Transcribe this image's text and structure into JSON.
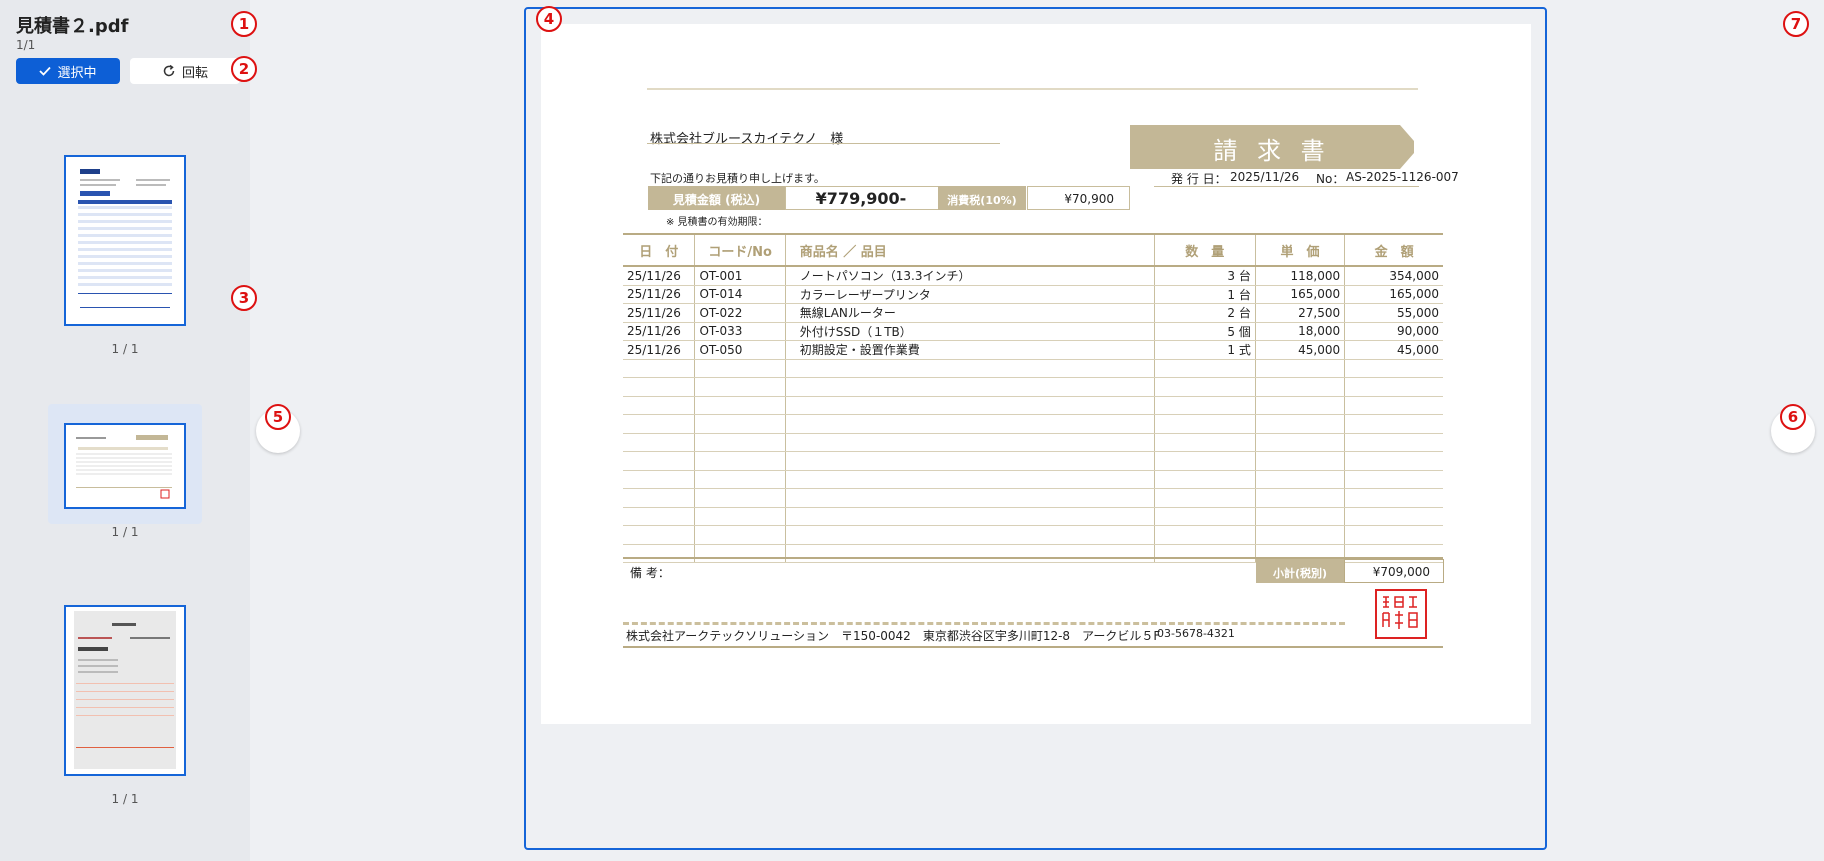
{
  "header": {
    "file_title": "見積書２.pdf",
    "page_count": "1/1",
    "select_button": "選択中",
    "rotate_button": "回転"
  },
  "thumbnails": [
    {
      "label": "1 / 1"
    },
    {
      "label": "1 / 1"
    },
    {
      "label": "1 / 1"
    }
  ],
  "badges": [
    "1",
    "2",
    "3",
    "4",
    "5",
    "6",
    "7"
  ],
  "document": {
    "recipient": "株式会社ブルースカイテクノ　様",
    "doc_title": "請 求 書",
    "issue_label": "発 行 日：",
    "issue_date": "2025/11/26",
    "no_label": "No：",
    "doc_no": "AS-2025-1126-007",
    "intro": "下記の通りお見積り申し上げます。",
    "total_label": "見積金額 (税込)",
    "total_value": "¥779,900-",
    "tax_label": "消費税(10%)",
    "tax_value": "¥70,900",
    "validity": "※ 見積書の有効期限：",
    "columns": [
      "日　付",
      "コード/No",
      "商品名 ／ 品目",
      "数　量",
      "単　価",
      "金　額"
    ],
    "rows": [
      {
        "date": "25/11/26",
        "code": "OT-001",
        "name": "ノートパソコン（13.3インチ）",
        "qty": "3 台",
        "unit": "118,000",
        "amount": "354,000"
      },
      {
        "date": "25/11/26",
        "code": "OT-014",
        "name": "カラーレーザープリンタ",
        "qty": "1 台",
        "unit": "165,000",
        "amount": "165,000"
      },
      {
        "date": "25/11/26",
        "code": "OT-022",
        "name": "無線LANルーター",
        "qty": "2 台",
        "unit": "27,500",
        "amount": "55,000"
      },
      {
        "date": "25/11/26",
        "code": "OT-033",
        "name": "外付けSSD（１TB）",
        "qty": "5 個",
        "unit": "18,000",
        "amount": "90,000"
      },
      {
        "date": "25/11/26",
        "code": "OT-050",
        "name": "初期設定・設置作業費",
        "qty": "1 式",
        "unit": "45,000",
        "amount": "45,000"
      }
    ],
    "remarks_label": "備 考：",
    "subtotal_label": "小計(税別)",
    "subtotal_value": "¥709,000",
    "footer_company": "株式会社アークテックソリューション　〒150-0042　東京都渋谷区宇多川町12-8　アークビル５F",
    "footer_phone": "03-5678-4321",
    "stamp_text": "株式会社日本サンプル印鑑証"
  },
  "colors": {
    "accent": "#1565d8",
    "select_button": "#0d5fd6",
    "gold": "#c3b796",
    "badge": "#dd1111"
  },
  "icons": {
    "select": "check-icon",
    "rotate": "rotate-icon"
  }
}
